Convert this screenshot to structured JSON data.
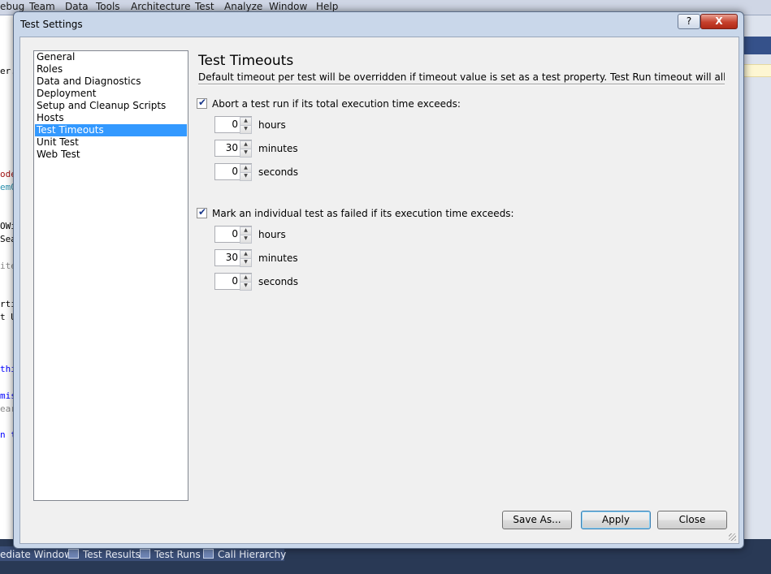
{
  "ide": {
    "menu": [
      "ebug",
      "Team",
      "Data",
      "Tools",
      "Architecture",
      "Test",
      "Analyze",
      "Window",
      "Help"
    ],
    "editor_fragments": [
      "er.c",
      "ode",
      "em0",
      "OWi",
      "Sea",
      "ite",
      "rti",
      "t U",
      "thi",
      "mis",
      "ear",
      "n t"
    ],
    "bottom_tabs": [
      "ediate Window",
      "Test Results",
      "Test Runs",
      "Call Hierarchy"
    ]
  },
  "dialog": {
    "title": "Test Settings",
    "help_glyph": "?",
    "close_glyph": "X",
    "categories": [
      {
        "label": "General",
        "selected": false
      },
      {
        "label": "Roles",
        "selected": false
      },
      {
        "label": "Data and Diagnostics",
        "selected": false
      },
      {
        "label": "Deployment",
        "selected": false
      },
      {
        "label": "Setup and Cleanup Scripts",
        "selected": false
      },
      {
        "label": "Hosts",
        "selected": false
      },
      {
        "label": "Test Timeouts",
        "selected": true
      },
      {
        "label": "Unit Test",
        "selected": false
      },
      {
        "label": "Web Test",
        "selected": false
      }
    ],
    "panel": {
      "title": "Test Timeouts",
      "description": "Default timeout per test will be overridden if timeout value is set as a test property. Test Run timeout will allow you to set...",
      "run_timeout": {
        "label": "Abort a test run if its total execution time exceeds:",
        "checked": true,
        "hours": "0",
        "hours_label": "hours",
        "minutes": "30",
        "minutes_label": "minutes",
        "seconds": "0",
        "seconds_label": "seconds"
      },
      "test_timeout": {
        "label": "Mark an individual test as failed if its execution time exceeds:",
        "checked": true,
        "hours": "0",
        "hours_label": "hours",
        "minutes": "30",
        "minutes_label": "minutes",
        "seconds": "0",
        "seconds_label": "seconds"
      }
    },
    "buttons": {
      "save_as": "Save As...",
      "apply": "Apply",
      "close": "Close"
    }
  }
}
